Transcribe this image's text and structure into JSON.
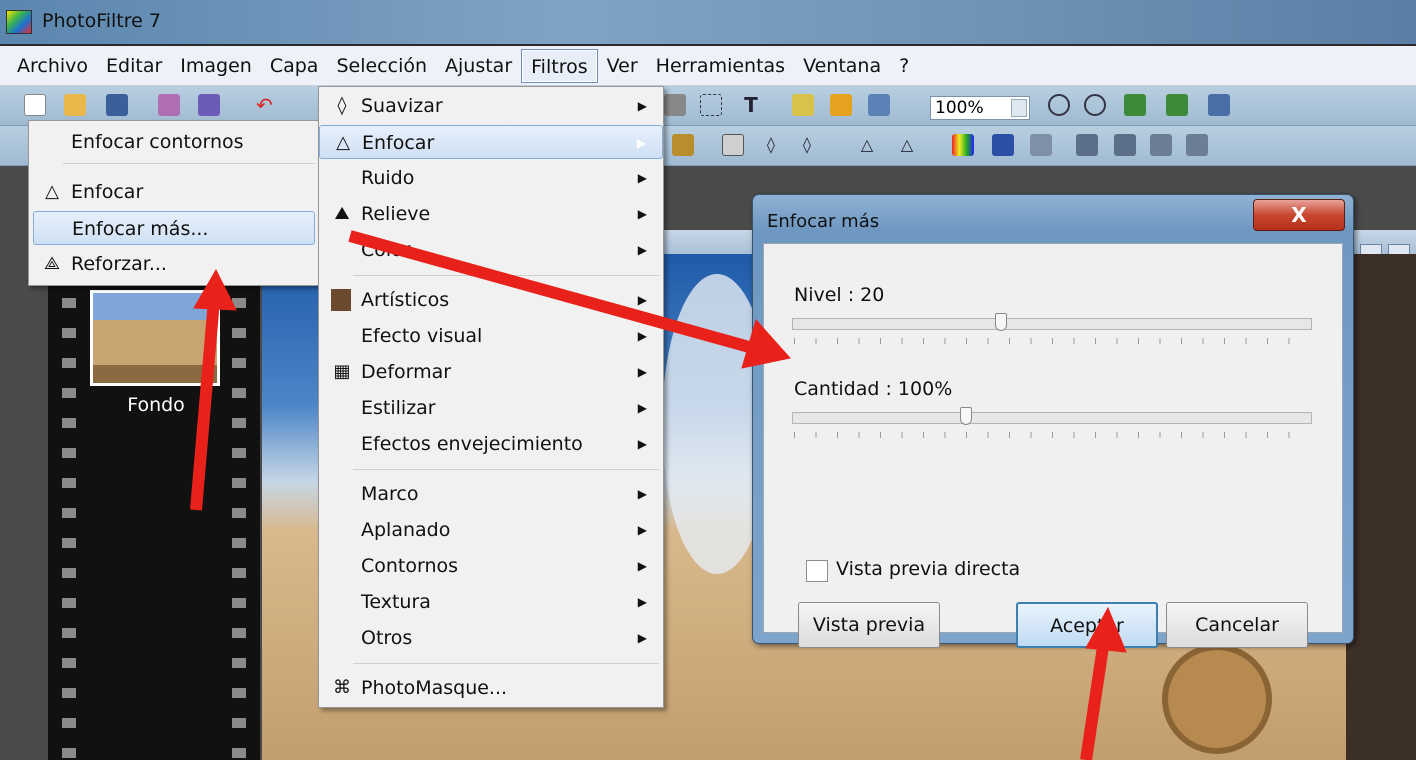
{
  "window": {
    "title": "PhotoFiltre 7"
  },
  "menubar": {
    "items": [
      "Archivo",
      "Editar",
      "Imagen",
      "Capa",
      "Selección",
      "Ajustar",
      "Filtros",
      "Ver",
      "Herramientas",
      "Ventana",
      "?"
    ],
    "active": "Filtros"
  },
  "toolbar": {
    "zoom": "100%"
  },
  "layers": {
    "layer_name": "Fondo"
  },
  "submenu_enfocar": {
    "items": [
      {
        "label": "Enfocar contornos",
        "icon": ""
      },
      {
        "label": "Enfocar",
        "icon": "droplet-icon"
      },
      {
        "label": "Enfocar más...",
        "icon": "",
        "highlighted": true
      },
      {
        "label": "Reforzar...",
        "icon": "double-droplet-icon"
      }
    ]
  },
  "filtros_menu": {
    "items": [
      {
        "label": "Suavizar",
        "icon": "droplet-icon",
        "submenu": true
      },
      {
        "label": "Enfocar",
        "icon": "droplet-icon",
        "submenu": true,
        "highlighted": true
      },
      {
        "label": "Ruido",
        "submenu": true
      },
      {
        "label": "Relieve",
        "icon": "relief-icon",
        "submenu": true
      },
      {
        "label": "Color",
        "submenu": true
      },
      {
        "label": "Artísticos",
        "icon": "portrait-icon",
        "submenu": true
      },
      {
        "label": "Efecto visual",
        "submenu": true
      },
      {
        "label": "Deformar",
        "icon": "grid-icon",
        "submenu": true
      },
      {
        "label": "Estilizar",
        "submenu": true
      },
      {
        "label": "Efectos envejecimiento",
        "submenu": true
      },
      {
        "label": "Marco",
        "submenu": true
      },
      {
        "label": "Aplanado",
        "submenu": true
      },
      {
        "label": "Contornos",
        "submenu": true
      },
      {
        "label": "Textura",
        "submenu": true
      },
      {
        "label": "Otros",
        "submenu": true
      },
      {
        "label": "PhotoMasque...",
        "icon": "mask-icon"
      }
    ]
  },
  "dialog": {
    "title": "Enfocar más",
    "close_label": "X",
    "nivel_label": "Nivel : 20",
    "nivel_value": 20,
    "cantidad_label": "Cantidad : 100%",
    "cantidad_value": 100,
    "preview_checkbox_label": "Vista previa directa",
    "preview_checked": false,
    "preview_button": "Vista previa",
    "accept_button": "Aceptar",
    "cancel_button": "Cancelar"
  },
  "colors": {
    "annotation_arrow": "#e8221a",
    "menu_highlight": "#cfe0f4",
    "dialog_frame": "#7da4cb"
  }
}
